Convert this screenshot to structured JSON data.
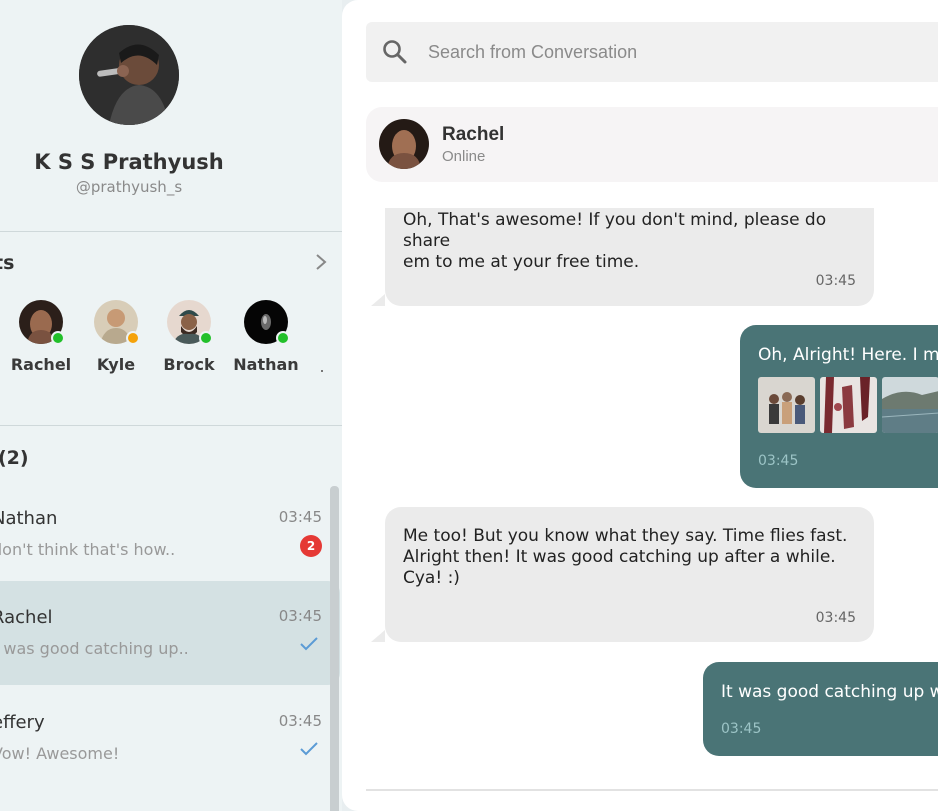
{
  "profile": {
    "name": "K S S Prathyush",
    "handle": "@prathyush_s"
  },
  "online_section": {
    "title": "ts",
    "users": [
      {
        "name": "Rachel",
        "status_color": "#22c02a"
      },
      {
        "name": "Kyle",
        "status_color": "#f5a20a"
      },
      {
        "name": "Brock",
        "status_color": "#22c02a"
      },
      {
        "name": "Nathan",
        "status_color": "#22c02a"
      }
    ]
  },
  "chats_section": {
    "title": "(2)",
    "items": [
      {
        "name": "Nathan",
        "preview": "don't think that's how..",
        "time": "03:45",
        "unread": "2"
      },
      {
        "name": "Rachel",
        "preview": "t was good catching up..",
        "time": "03:45"
      },
      {
        "name": "effery",
        "preview": "Vow! Awesome!",
        "time": "03:45"
      }
    ]
  },
  "search": {
    "placeholder": "Search from Conversation"
  },
  "conversation": {
    "contact_name": "Rachel",
    "contact_status": "Online",
    "messages": [
      {
        "direction": "in",
        "line1": "Oh, That's awesome! If you don't mind, please do share",
        "line2": "em to me at your free time.",
        "time": "03:45"
      },
      {
        "direction": "out",
        "text": "Oh, Alright! Here. I mis",
        "time": "03:45"
      },
      {
        "direction": "in",
        "line1": "Me too! But you know what they say. Time flies fast.",
        "line2": "Alright then! It was good catching up after a while.",
        "line3": "Cya! :)",
        "time": "03:45"
      },
      {
        "direction": "out",
        "text": "It was good catching up wi",
        "time": "03:45"
      }
    ]
  },
  "colors": {
    "accent": "#4a7476",
    "incoming_bubble": "#ebebeb",
    "unread_badge": "#e53935",
    "read_check": "#5b9bd5"
  }
}
